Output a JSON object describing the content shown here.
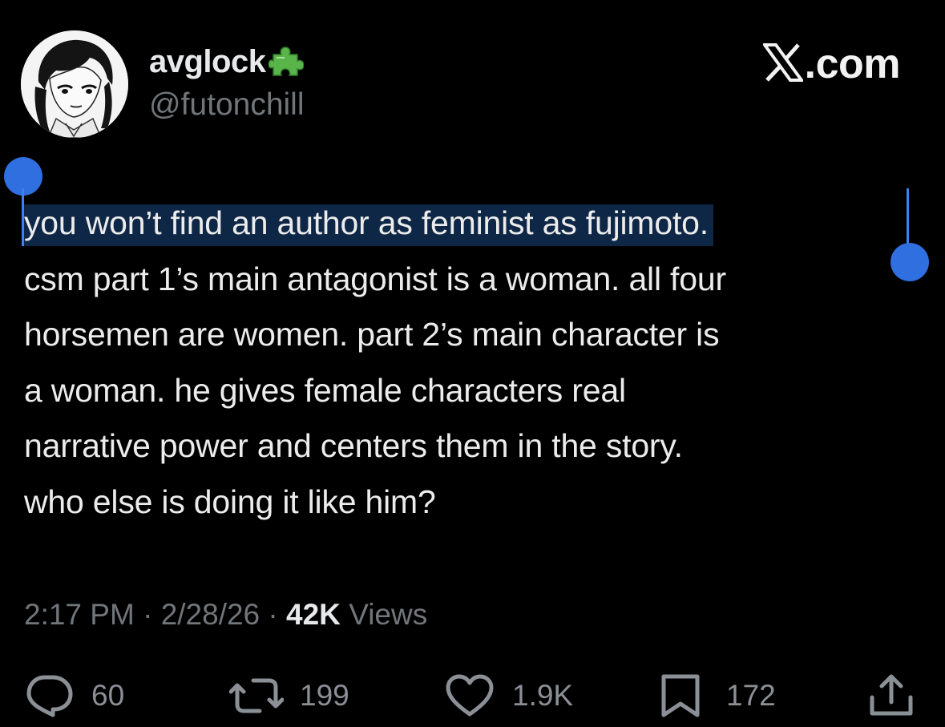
{
  "author": {
    "display_name": "avglock",
    "handle": "@futonchill",
    "badge_icon": "puzzle-piece-icon",
    "avatar": "manga-character-avatar"
  },
  "brand": {
    "logo_icon": "x-logo-icon",
    "text": ".com"
  },
  "tweet": {
    "selected_text": "you won’t find an author as feminist as fujimoto.",
    "lines": [
      "csm part 1’s main antagonist is a woman. all four",
      "horsemen are women. part 2’s main character is",
      "a woman. he gives female characters real",
      "narrative power and centers them in the story.",
      "who else is doing it like him?"
    ]
  },
  "meta": {
    "time": "2:17 PM",
    "date": "2/28/26",
    "separator": " · ",
    "views_count": "42K",
    "views_label": " Views"
  },
  "actions": {
    "replies": {
      "icon": "reply-icon",
      "count": "60"
    },
    "reposts": {
      "icon": "repost-icon",
      "count": "199"
    },
    "likes": {
      "icon": "heart-icon",
      "count": "1.9K"
    },
    "bookmarks": {
      "icon": "bookmark-icon",
      "count": "172"
    },
    "share": {
      "icon": "share-icon"
    }
  },
  "colors": {
    "background": "#000000",
    "primary_text": "#e7e9ea",
    "secondary_text": "#71767b",
    "selection_highlight": "#0f2746",
    "selection_handle": "#2f6fe0"
  }
}
